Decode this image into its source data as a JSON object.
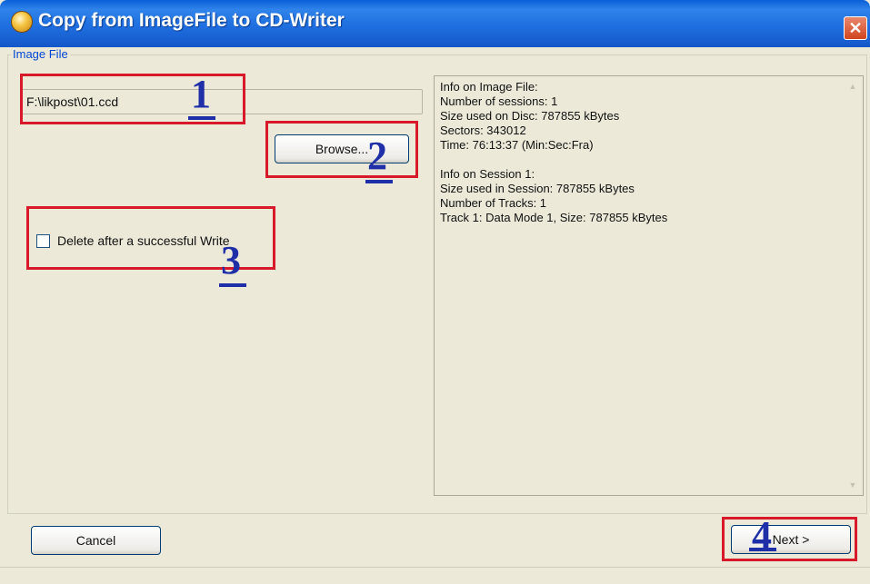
{
  "window": {
    "title": "Copy from ImageFile to CD-Writer",
    "close_glyph": "✕"
  },
  "image_file": {
    "group_label": "Image File",
    "path_value": "F:\\likpost\\01.ccd",
    "browse_label": "Browse...",
    "delete_checkbox_label": "Delete after a successful Write",
    "delete_checked": false
  },
  "info": {
    "lines": [
      "Info on Image File:",
      "Number of sessions: 1",
      "Size used on Disc: 787855 kBytes",
      "Sectors: 343012",
      "Time: 76:13:37 (Min:Sec:Fra)",
      "",
      "Info on Session 1:",
      "Size used in Session: 787855 kBytes",
      "Number of Tracks: 1",
      "Track 1: Data Mode 1, Size: 787855 kBytes"
    ]
  },
  "footer": {
    "cancel_label": "Cancel",
    "next_label": "Next >"
  },
  "annotations": {
    "color": "#d8192a",
    "number_color": "#1f2fa8",
    "labels": [
      "1",
      "2",
      "3",
      "4"
    ]
  }
}
